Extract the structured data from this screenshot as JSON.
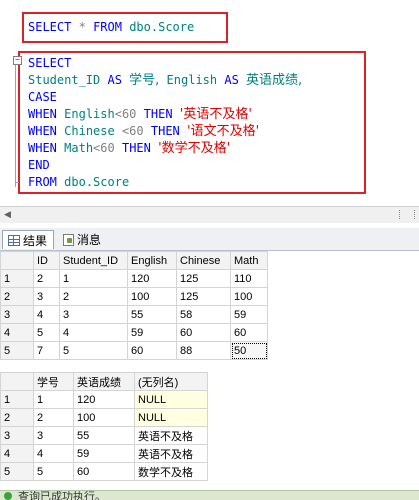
{
  "editor": {
    "query1": [
      "SELECT",
      "*",
      "FROM",
      "dbo.Score"
    ],
    "query2": {
      "select_kw": "SELECT",
      "col1": "Student_ID",
      "as_kw": "AS",
      "alias1": "学号,",
      "col2": "English",
      "alias2": "英语成绩,",
      "case_kw": "CASE",
      "when1": {
        "kw": "WHEN",
        "col": "English",
        "op": "<60",
        "then": "THEN",
        "val": "'英语不及格'"
      },
      "when2": {
        "kw": "WHEN",
        "col": "Chinese",
        "op": "<60",
        "then": "THEN",
        "val": "'语文不及格'"
      },
      "when3": {
        "kw": "WHEN",
        "col": "Math",
        "op": "<60",
        "then": "THEN",
        "val": "'数学不及格'"
      },
      "end_kw": "END",
      "from_kw": "FROM",
      "table": "dbo.Score"
    }
  },
  "tabs": {
    "results": "结果",
    "messages": "消息"
  },
  "grid1": {
    "headers": [
      "ID",
      "Student_ID",
      "English",
      "Chinese",
      "Math"
    ],
    "rows": [
      {
        "n": "1",
        "cells": [
          "2",
          "1",
          "120",
          "125",
          "110"
        ]
      },
      {
        "n": "2",
        "cells": [
          "3",
          "2",
          "100",
          "125",
          "100"
        ]
      },
      {
        "n": "3",
        "cells": [
          "4",
          "3",
          "55",
          "58",
          "59"
        ]
      },
      {
        "n": "4",
        "cells": [
          "5",
          "4",
          "59",
          "60",
          "60"
        ]
      },
      {
        "n": "5",
        "cells": [
          "7",
          "5",
          "60",
          "88",
          "50"
        ]
      }
    ]
  },
  "grid2": {
    "headers": [
      "学号",
      "英语成绩",
      "(无列名)"
    ],
    "rows": [
      {
        "n": "1",
        "cells": [
          "1",
          "120",
          "NULL"
        ]
      },
      {
        "n": "2",
        "cells": [
          "2",
          "100",
          "NULL"
        ]
      },
      {
        "n": "3",
        "cells": [
          "3",
          "55",
          "英语不及格"
        ]
      },
      {
        "n": "4",
        "cells": [
          "4",
          "59",
          "英语不及格"
        ]
      },
      {
        "n": "5",
        "cells": [
          "5",
          "60",
          "数学不及格"
        ]
      }
    ]
  },
  "status": {
    "text": "查询已成功执行。"
  },
  "colors": {
    "keyword": "#0000ff",
    "object": "#008080",
    "string": "#e00000",
    "highlight_box": "#d9222a"
  }
}
